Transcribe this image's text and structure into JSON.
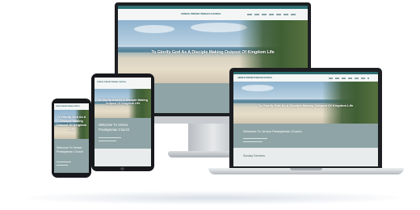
{
  "church_name": "VENICE PRESBYTERIAN CHURCH",
  "hero_tagline": "To Glorify God As A Disciple Making Outpost Of Kingdom Life",
  "welcome_heading": "Welcome To Venice Presbyterian Church",
  "sunday_services_heading": "Sunday Services",
  "colors": {
    "teal": "#2f6f73",
    "band": "#8fa4a6",
    "screen_bezel": "#1d1f22"
  }
}
